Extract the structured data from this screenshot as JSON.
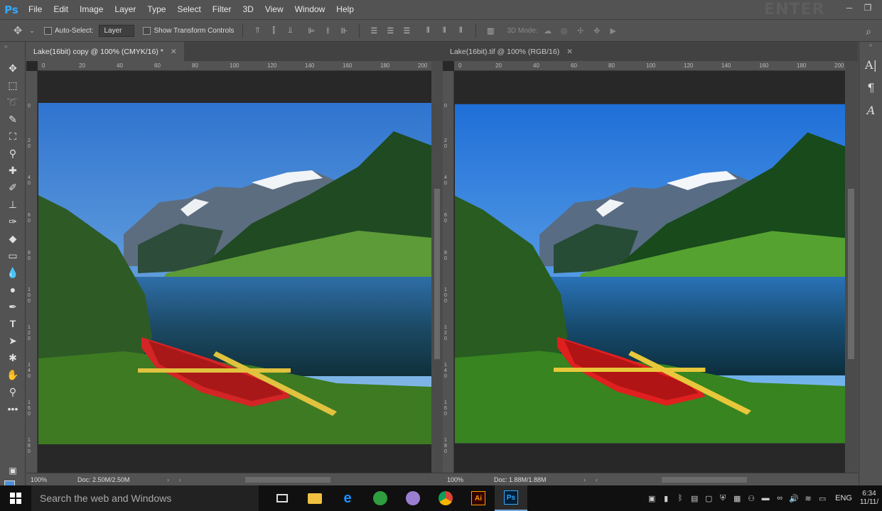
{
  "app": {
    "logo": "Ps"
  },
  "menu": [
    "File",
    "Edit",
    "Image",
    "Layer",
    "Type",
    "Select",
    "Filter",
    "3D",
    "View",
    "Window",
    "Help"
  ],
  "watermark": "ENTER FOCUS",
  "options_bar": {
    "auto_select_label": "Auto-Select:",
    "auto_select_value": "Layer",
    "show_transform_label": "Show Transform Controls",
    "mode_3d_label": "3D Mode:"
  },
  "documents": [
    {
      "title": "Lake(16bit) copy @ 100% (CMYK/16) *",
      "zoom": "100%",
      "doc_size": "Doc: 2.50M/2.50M"
    },
    {
      "title": "Lake(16bit).tif @ 100% (RGB/16)",
      "zoom": "100%",
      "doc_size": "Doc: 1.88M/1.88M"
    }
  ],
  "ruler_h": [
    "0",
    "20",
    "40",
    "60",
    "80",
    "100",
    "120",
    "140",
    "160",
    "180",
    "200"
  ],
  "ruler_v": [
    "0",
    "2 0",
    "4 0",
    "6 0",
    "8 0",
    "1 0 0",
    "1 2 0",
    "1 4 0",
    "1 6 0",
    "1 8 0"
  ],
  "colors": {
    "foreground": "#4a90d9",
    "background": "#ffffff"
  },
  "taskbar": {
    "search_placeholder": "Search the web and Windows",
    "language": "ENG",
    "time": "6:34",
    "date": "11/11/"
  }
}
